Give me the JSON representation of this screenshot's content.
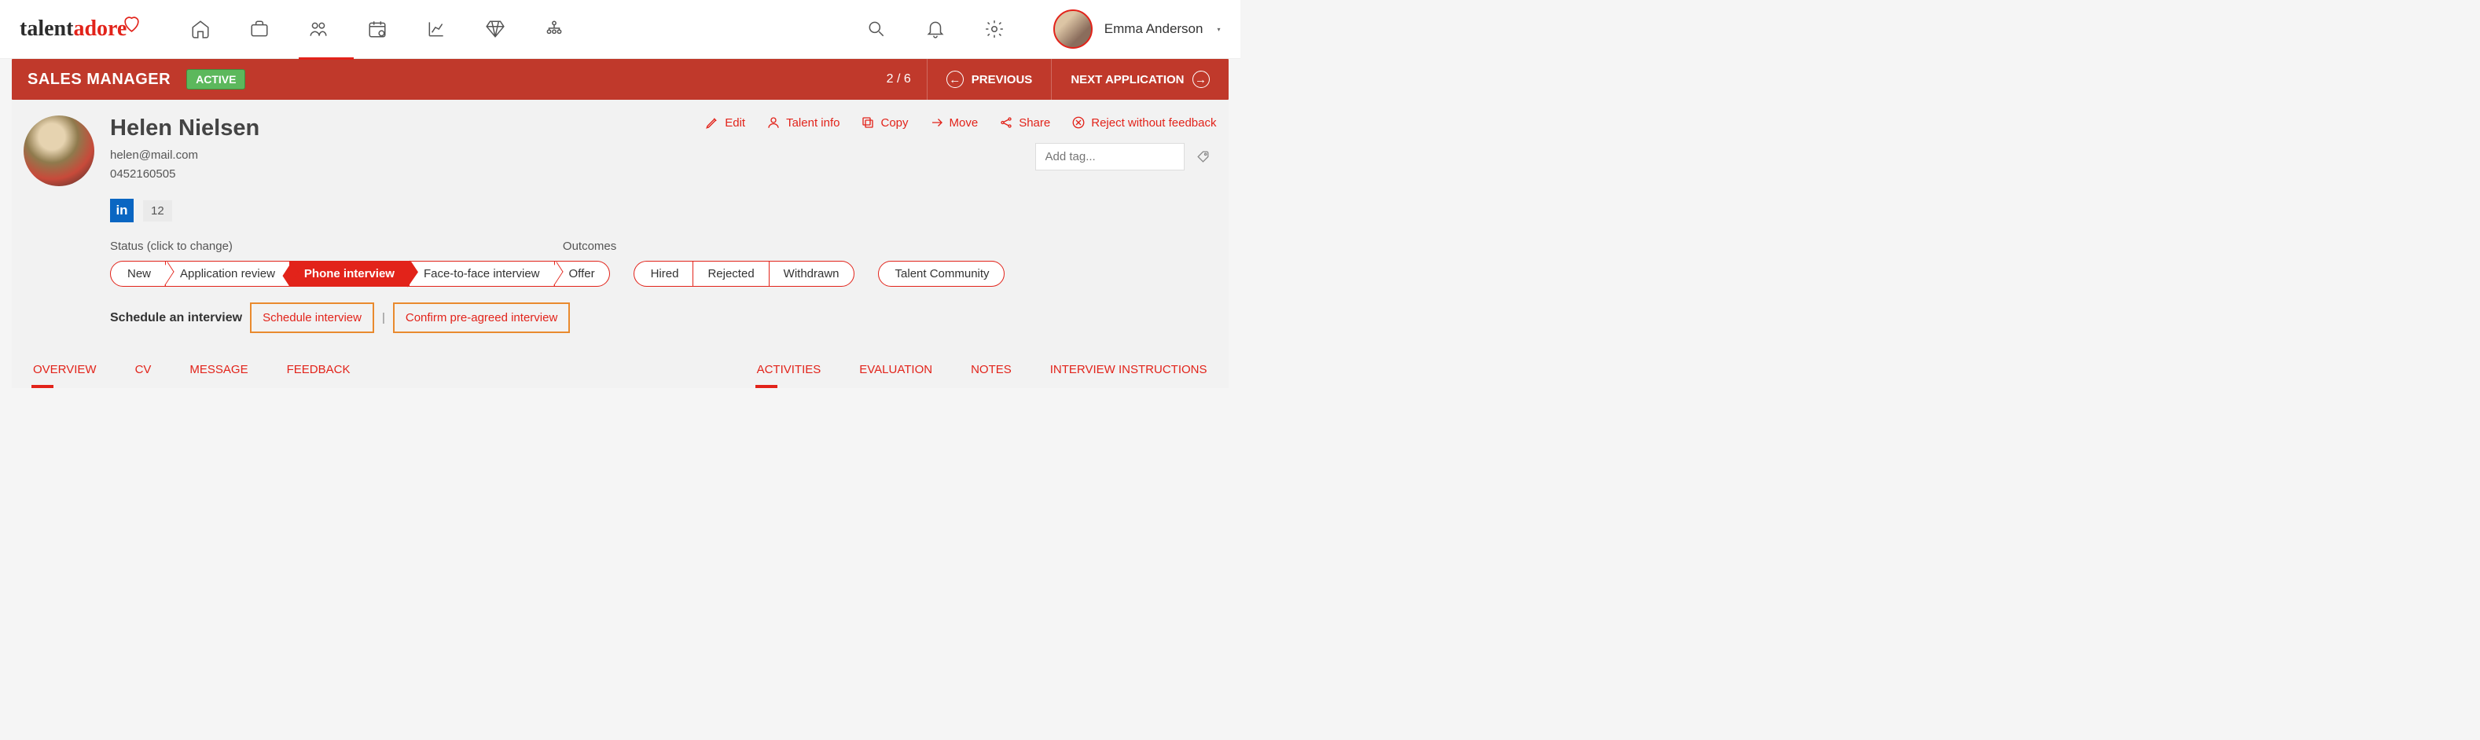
{
  "brand": {
    "part1": "talent",
    "part2": "adore"
  },
  "user": {
    "name": "Emma Anderson"
  },
  "header": {
    "title": "SALES MANAGER",
    "status": "ACTIVE",
    "counter": "2 / 6",
    "prev": "PREVIOUS",
    "next": "NEXT APPLICATION"
  },
  "candidate": {
    "name": "Helen Nielsen",
    "email": "helen@mail.com",
    "phone": "0452160505",
    "linkedin_count": "12"
  },
  "actions": {
    "edit": "Edit",
    "talent_info": "Talent info",
    "copy": "Copy",
    "move": "Move",
    "share": "Share",
    "reject": "Reject without feedback"
  },
  "tag_input": {
    "placeholder": "Add tag..."
  },
  "status_section": {
    "label": "Status (click to change)",
    "stages": [
      "New",
      "Application review",
      "Phone interview",
      "Face-to-face interview",
      "Offer"
    ],
    "active_stage_index": 2
  },
  "outcomes_section": {
    "label": "Outcomes",
    "options": [
      "Hired",
      "Rejected",
      "Withdrawn"
    ],
    "extra": "Talent Community"
  },
  "schedule": {
    "label": "Schedule an interview",
    "schedule_btn": "Schedule interview",
    "confirm_btn": "Confirm pre-agreed interview"
  },
  "tabs_left": [
    "OVERVIEW",
    "CV",
    "MESSAGE",
    "FEEDBACK"
  ],
  "tabs_right": [
    "ACTIVITIES",
    "EVALUATION",
    "NOTES",
    "INTERVIEW INSTRUCTIONS"
  ]
}
